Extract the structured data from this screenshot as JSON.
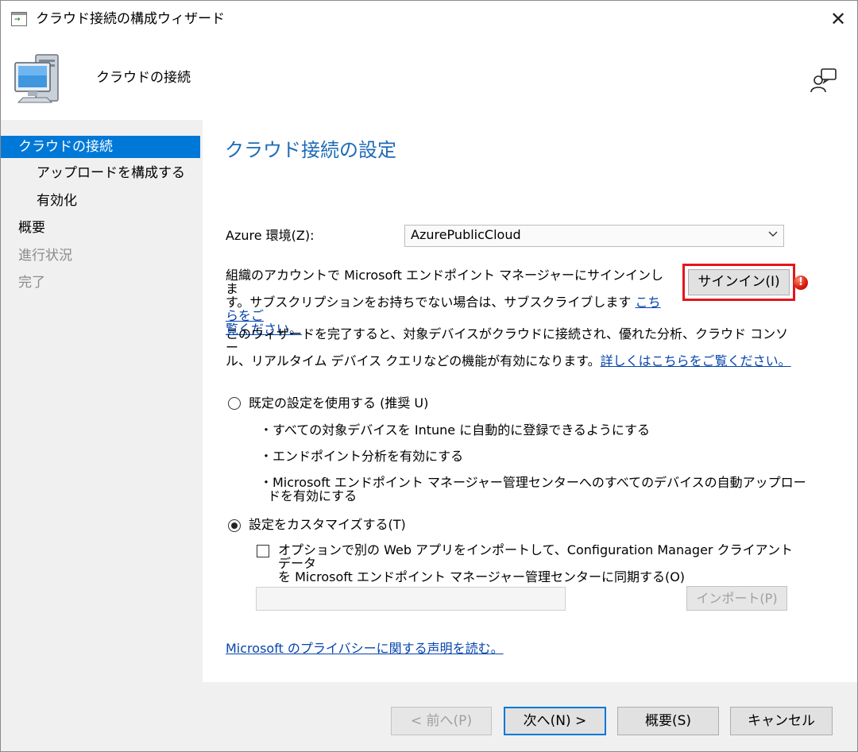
{
  "window": {
    "title": "クラウド接続の構成ウィザード",
    "close_symbol": "✕"
  },
  "header": {
    "title": "クラウドの接続"
  },
  "sidebar": {
    "items": [
      {
        "label": "クラウドの接続",
        "state": "active"
      },
      {
        "label": "アップロードを構成する",
        "state": "normal"
      },
      {
        "label": "有効化",
        "state": "normal"
      },
      {
        "label": "概要",
        "state": "normal"
      },
      {
        "label": "進行状況",
        "state": "disabled"
      },
      {
        "label": "完了",
        "state": "disabled"
      }
    ]
  },
  "main": {
    "title": "クラウド接続の設定",
    "azure_env": {
      "label": "Azure 環境(Z):",
      "value": "AzurePublicCloud"
    },
    "signin": {
      "text_line1": "組織のアカウントで Microsoft エンドポイント マネージャーにサインインしま",
      "text_line2": "す。サブスクリプションをお持ちでない場合は、サブスクライブします",
      "link_part1": "こちらをご",
      "link_part2": "覧ください。",
      "button_label": "サインイン(I)",
      "warning_symbol": "!"
    },
    "wizard_info": {
      "line1": "このウィザードを完了すると、対象デバイスがクラウドに接続され、優れた分析、クラウド コンソー",
      "line2": "ル、リアルタイム デバイス クエリなどの機能が有効になります。",
      "link": "詳しくはこちらをご覧ください。"
    },
    "option_default": {
      "label": "既定の設定を使用する (推奨 U)",
      "selected": false,
      "bullets": [
        "・すべての対象デバイスを Intune に自動的に登録できるようにする",
        "・エンドポイント分析を有効にする",
        "・Microsoft エンドポイント マネージャー管理センターへのすべてのデバイスの自動アップロー",
        "ドを有効にする"
      ]
    },
    "option_custom": {
      "label": "設定をカスタマイズする(T)",
      "selected": true,
      "checkbox_line1": "オプションで別の Web アプリをインポートして、Configuration Manager クライアント データ",
      "checkbox_line2": "を Microsoft エンドポイント マネージャー管理センターに同期する(O)",
      "checked": false,
      "textbox_value": "",
      "import_button": "インポート(P)"
    },
    "privacy_link": "Microsoft のプライバシーに関する声明を読む。"
  },
  "footer": {
    "prev": "< 前へ(P)",
    "next": "次へ(N) >",
    "summary": "概要(S)",
    "cancel": "キャンセル"
  },
  "colors": {
    "accent": "#0078d7",
    "title_blue": "#1d6bb8",
    "link": "#0645ad",
    "highlight_red": "#e5161c",
    "sidebar_bg": "#f0f0f0"
  }
}
